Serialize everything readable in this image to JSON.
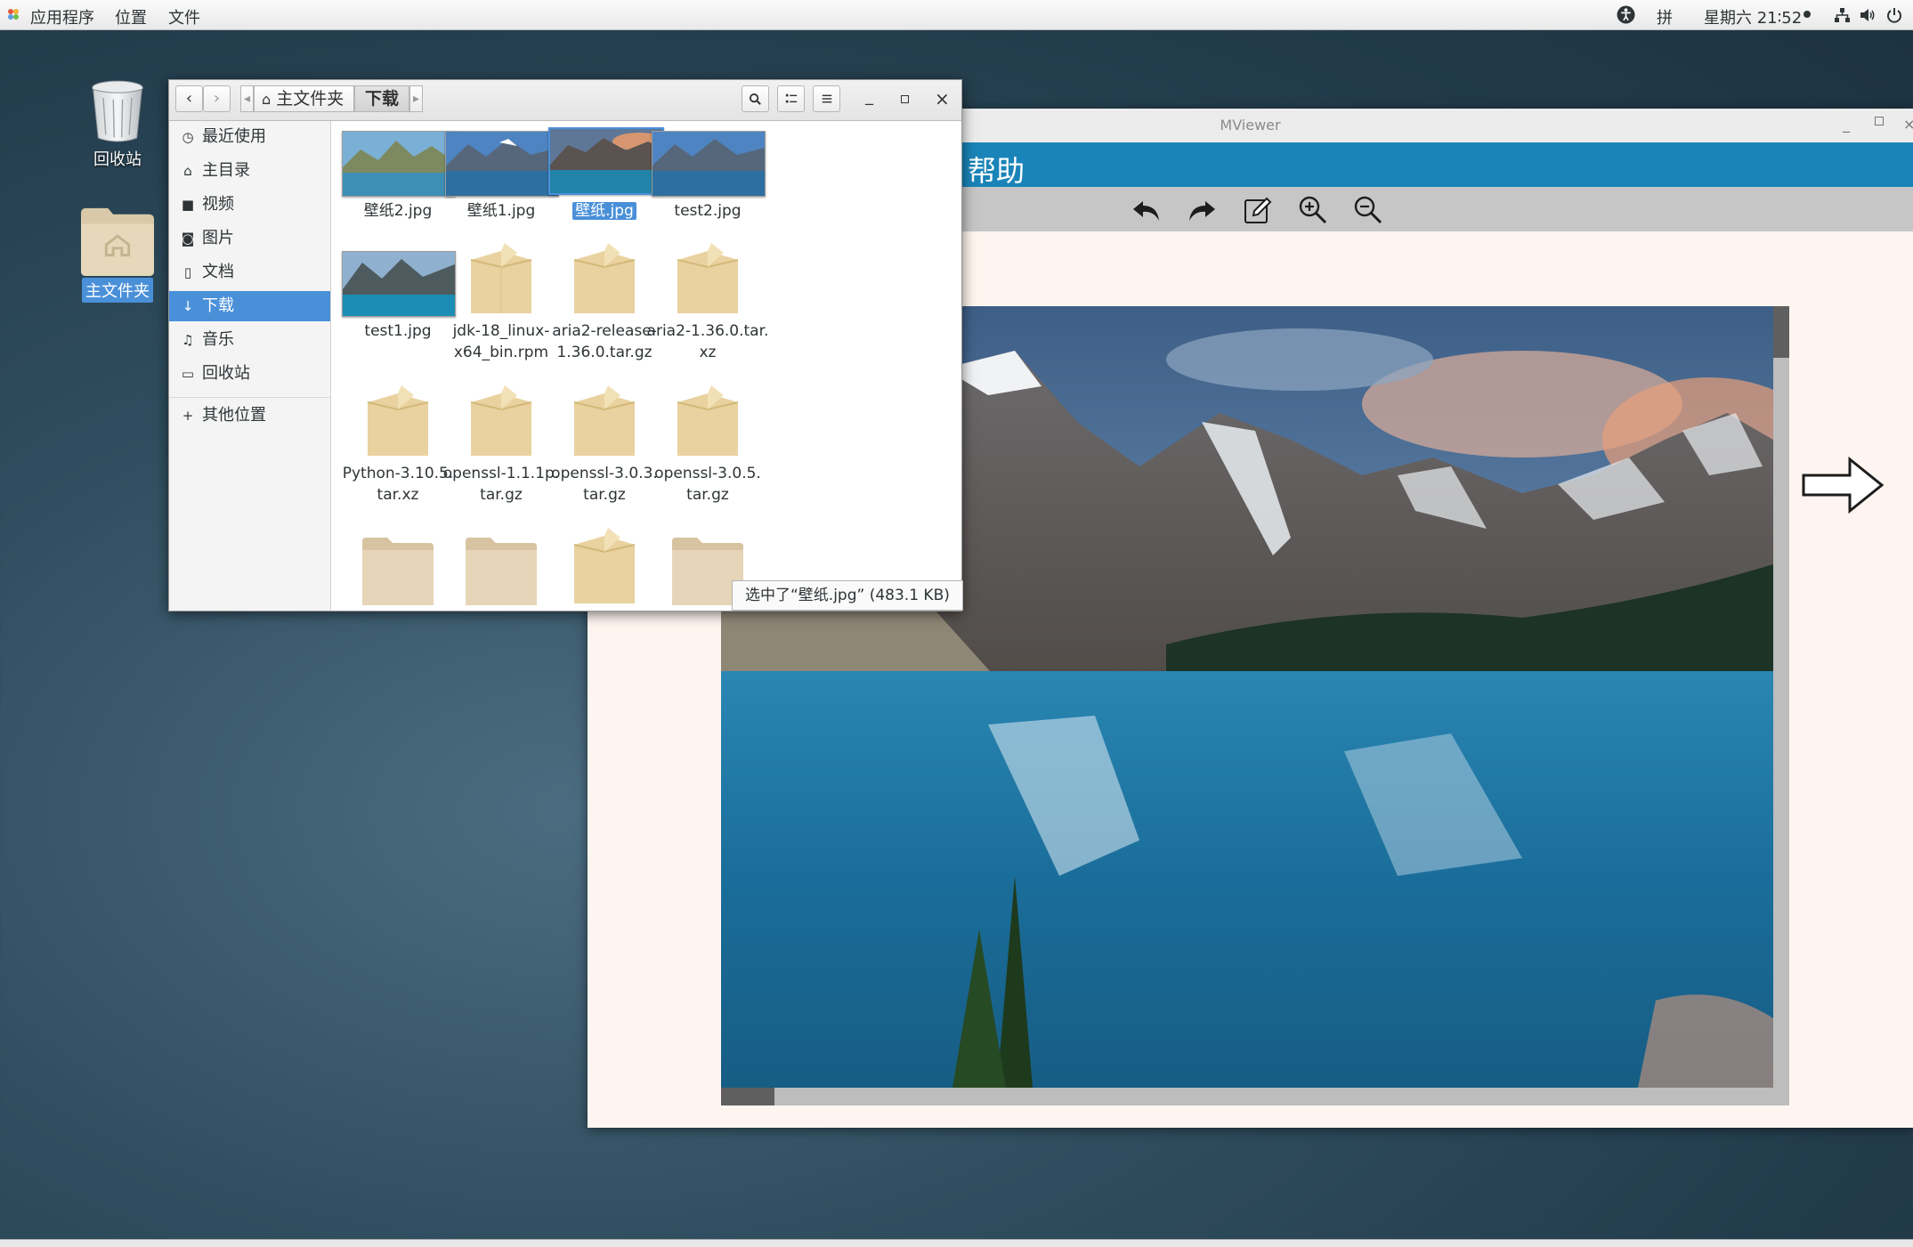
{
  "topbar": {
    "applications": "应用程序",
    "places": "位置",
    "files": "文件",
    "input_method": "拼",
    "clock": "星期六 21∶52",
    "icons": [
      "accessibility-icon",
      "network-icon",
      "volume-icon",
      "power-icon"
    ]
  },
  "desktop": {
    "trash_label": "回收站",
    "home_label": "主文件夹"
  },
  "mviewer": {
    "title": "MViewer",
    "menu_help": "帮助",
    "toolbar_icons": [
      "undo-icon",
      "redo-icon",
      "edit-icon",
      "zoom-in-icon",
      "zoom-out-icon"
    ],
    "accent_color": "#1a84b8"
  },
  "files": {
    "path": {
      "home": "主文件夹",
      "current": "下载"
    },
    "sidebar": [
      {
        "label": "最近使用",
        "icon": "clock-icon"
      },
      {
        "label": "主目录",
        "icon": "home-icon"
      },
      {
        "label": "视频",
        "icon": "video-icon"
      },
      {
        "label": "图片",
        "icon": "camera-icon"
      },
      {
        "label": "文档",
        "icon": "document-icon"
      },
      {
        "label": "下载",
        "icon": "download-icon",
        "active": true
      },
      {
        "label": "音乐",
        "icon": "music-icon"
      },
      {
        "label": "回收站",
        "icon": "trash-icon"
      },
      {
        "label": "其他位置",
        "icon": "plus-icon"
      }
    ],
    "items": [
      {
        "name": "壁纸2.jpg",
        "type": "image"
      },
      {
        "name": "壁纸1.jpg",
        "type": "image"
      },
      {
        "name": "壁纸.jpg",
        "type": "image",
        "selected": true
      },
      {
        "name": "test2.jpg",
        "type": "image"
      },
      {
        "name": "test1.jpg",
        "type": "image"
      },
      {
        "name": "jdk-18_linux-\nx64_bin.rpm",
        "type": "package"
      },
      {
        "name": "aria2-release-\n1.36.0.tar.gz",
        "type": "package"
      },
      {
        "name": "aria2-1.36.0.tar.\nxz",
        "type": "package"
      },
      {
        "name": "Python-3.10.5.\ntar.xz",
        "type": "package"
      },
      {
        "name": "openssl-1.1.1p.\ntar.gz",
        "type": "package"
      },
      {
        "name": "openssl-3.0.3.\ntar.gz",
        "type": "package"
      },
      {
        "name": "openssl-3.0.5.\ntar.gz",
        "type": "package"
      }
    ],
    "status": "选中了“壁纸.jpg” (483.1 KB)",
    "selection_color": "#4a90d9"
  }
}
